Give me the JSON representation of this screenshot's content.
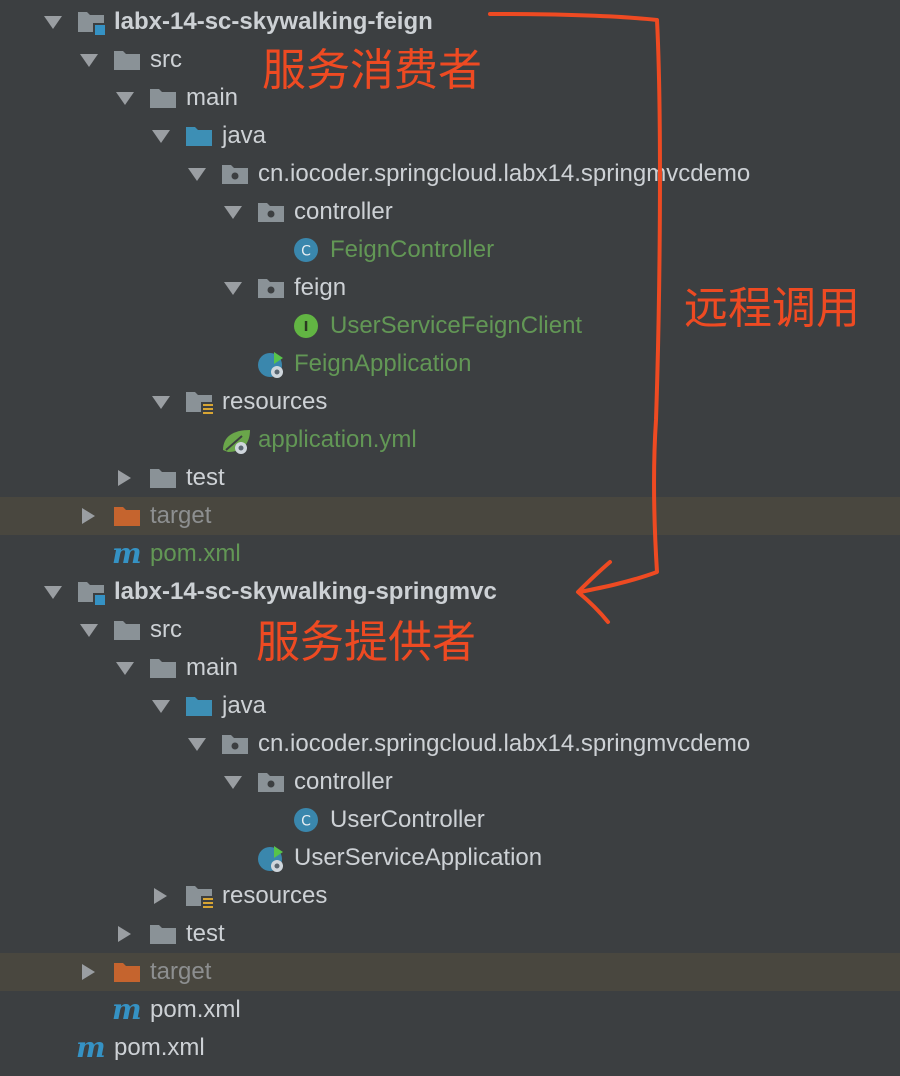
{
  "tree": [
    {
      "label": "labx-14-sc-skywalking-feign",
      "depth": 0,
      "expanded": true,
      "icon": "module-folder-icon",
      "style": "bold",
      "name": "module-labx-14-sc-skywalking-feign"
    },
    {
      "label": "src",
      "depth": 1,
      "expanded": true,
      "icon": "folder-icon",
      "name": "folder-src"
    },
    {
      "label": "main",
      "depth": 2,
      "expanded": true,
      "icon": "folder-icon",
      "name": "folder-main"
    },
    {
      "label": "java",
      "depth": 3,
      "expanded": true,
      "icon": "source-root-folder-icon",
      "name": "folder-java"
    },
    {
      "label": "cn.iocoder.springcloud.labx14.springmvcdemo",
      "depth": 4,
      "expanded": true,
      "icon": "package-icon",
      "name": "package-springmvcdemo"
    },
    {
      "label": "controller",
      "depth": 5,
      "expanded": true,
      "icon": "package-icon",
      "name": "package-controller"
    },
    {
      "label": "FeignController",
      "depth": 6,
      "icon": "class-icon",
      "style": "green",
      "name": "file-feigncontroller"
    },
    {
      "label": "feign",
      "depth": 5,
      "expanded": true,
      "icon": "package-icon",
      "name": "package-feign"
    },
    {
      "label": "UserServiceFeignClient",
      "depth": 6,
      "icon": "interface-icon",
      "style": "green",
      "name": "file-userservicefeignclient"
    },
    {
      "label": "FeignApplication",
      "depth": 5,
      "icon": "spring-boot-app-icon",
      "style": "green",
      "name": "file-feignapplication"
    },
    {
      "label": "resources",
      "depth": 3,
      "expanded": true,
      "icon": "resources-folder-icon",
      "name": "folder-resources"
    },
    {
      "label": "application.yml",
      "depth": 4,
      "icon": "spring-config-icon",
      "style": "green",
      "name": "file-application-yml"
    },
    {
      "label": "test",
      "depth": 2,
      "expanded": false,
      "icon": "folder-icon",
      "name": "folder-test"
    },
    {
      "label": "target",
      "depth": 1,
      "expanded": false,
      "icon": "excluded-folder-icon",
      "style": "muted",
      "excluded": true,
      "name": "folder-target"
    },
    {
      "label": "pom.xml",
      "depth": 1,
      "icon": "maven-icon",
      "style": "green",
      "name": "file-pom-xml"
    },
    {
      "label": "labx-14-sc-skywalking-springmvc",
      "depth": 0,
      "expanded": true,
      "icon": "module-folder-icon",
      "style": "bold",
      "name": "module-labx-14-sc-skywalking-springmvc"
    },
    {
      "label": "src",
      "depth": 1,
      "expanded": true,
      "icon": "folder-icon",
      "name": "folder-src"
    },
    {
      "label": "main",
      "depth": 2,
      "expanded": true,
      "icon": "folder-icon",
      "name": "folder-main"
    },
    {
      "label": "java",
      "depth": 3,
      "expanded": true,
      "icon": "source-root-folder-icon",
      "name": "folder-java"
    },
    {
      "label": "cn.iocoder.springcloud.labx14.springmvcdemo",
      "depth": 4,
      "expanded": true,
      "icon": "package-icon",
      "name": "package-springmvcdemo"
    },
    {
      "label": "controller",
      "depth": 5,
      "expanded": true,
      "icon": "package-icon",
      "name": "package-controller"
    },
    {
      "label": "UserController",
      "depth": 6,
      "icon": "class-icon",
      "name": "file-usercontroller"
    },
    {
      "label": "UserServiceApplication",
      "depth": 5,
      "icon": "spring-boot-app-icon",
      "name": "file-userserviceapplication"
    },
    {
      "label": "resources",
      "depth": 3,
      "expanded": false,
      "icon": "resources-folder-icon",
      "name": "folder-resources"
    },
    {
      "label": "test",
      "depth": 2,
      "expanded": false,
      "icon": "folder-icon",
      "name": "folder-test"
    },
    {
      "label": "target",
      "depth": 1,
      "expanded": false,
      "icon": "excluded-folder-icon",
      "style": "muted",
      "excluded": true,
      "name": "folder-target"
    },
    {
      "label": "pom.xml",
      "depth": 1,
      "icon": "maven-icon",
      "name": "file-pom-xml"
    },
    {
      "label": "pom.xml",
      "depth": 0,
      "icon": "maven-icon",
      "name": "file-pom-xml"
    }
  ],
  "annotations": {
    "consumer": "服务消费者",
    "remote_call": "远程调用",
    "provider": "服务提供者",
    "color": "#ee4a22"
  },
  "colors": {
    "background": "#3c3f41",
    "excluded_row": "#49473f",
    "text": "#cdd1d5",
    "vcs_new_green": "#629755",
    "muted": "#8d8f90",
    "folder": "#8a9297",
    "source_folder": "#3d8fb5",
    "target_folder": "#c5642e",
    "module_badge": "#3592c4",
    "class_icon": "#3a87ad",
    "interface_icon": "#62b543",
    "maven": "#3592c4"
  }
}
